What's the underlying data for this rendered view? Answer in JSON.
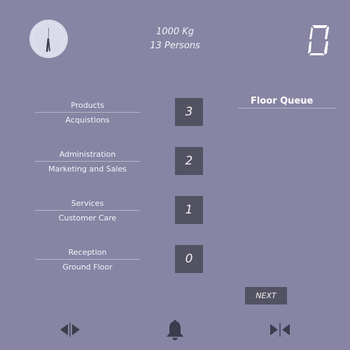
{
  "header": {
    "capacity_weight": "1000 Kg",
    "capacity_persons": "13 Persons",
    "current_floor_display": "0"
  },
  "floors": [
    {
      "name": "Products",
      "department": "Acquistions",
      "button": "3"
    },
    {
      "name": "Administration",
      "department": "Marketing and Sales",
      "button": "2"
    },
    {
      "name": "Services",
      "department": "Customer Care",
      "button": "1"
    },
    {
      "name": "Reception",
      "department": "Ground Floor",
      "button": "0"
    }
  ],
  "queue": {
    "title": "Floor Queue"
  },
  "next_label": "NEXT",
  "controls": {
    "open_icon": "doors-open-icon",
    "alarm_icon": "bell-icon",
    "close_icon": "doors-close-icon"
  },
  "colors": {
    "background": "#8785a3",
    "button": "#535262",
    "controls": "#3d3c4d"
  }
}
